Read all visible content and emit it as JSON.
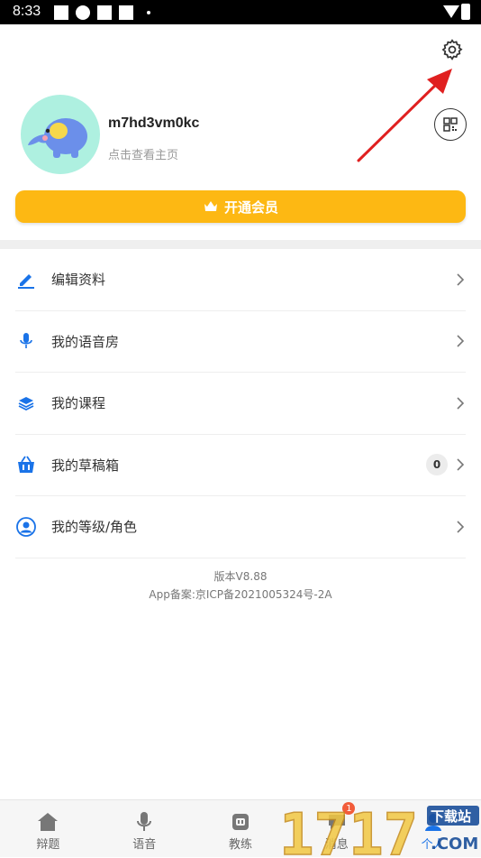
{
  "status_bar": {
    "time": "8:33"
  },
  "profile": {
    "username": "m7hd3vm0kc",
    "hint": "点击查看主页"
  },
  "vip": {
    "label": "开通会员"
  },
  "menu": [
    {
      "label": "编辑资料",
      "icon": "pencil-icon"
    },
    {
      "label": "我的语音房",
      "icon": "microphone-icon"
    },
    {
      "label": "我的课程",
      "icon": "layers-icon"
    },
    {
      "label": "我的草稿箱",
      "icon": "basket-icon",
      "count": "0"
    },
    {
      "label": "我的等级/角色",
      "icon": "user-icon"
    }
  ],
  "footer": {
    "version": "版本V8.88",
    "icp": "App备案:京ICP备2021005324号-2A"
  },
  "tabs": [
    {
      "label": "辩题",
      "icon": "home-icon"
    },
    {
      "label": "语音",
      "icon": "microphone-icon"
    },
    {
      "label": "教练",
      "icon": "ai-coach-icon"
    },
    {
      "label": "消息",
      "icon": "message-icon",
      "badge": "1"
    },
    {
      "label": "个人",
      "icon": "person-icon"
    }
  ],
  "watermark": {
    "text": "1717",
    "tag": "下载站",
    "tld": ".COM"
  },
  "colors": {
    "accent": "#fdb813",
    "icon_blue": "#1a73e8",
    "badge_red": "#f25c3a"
  }
}
